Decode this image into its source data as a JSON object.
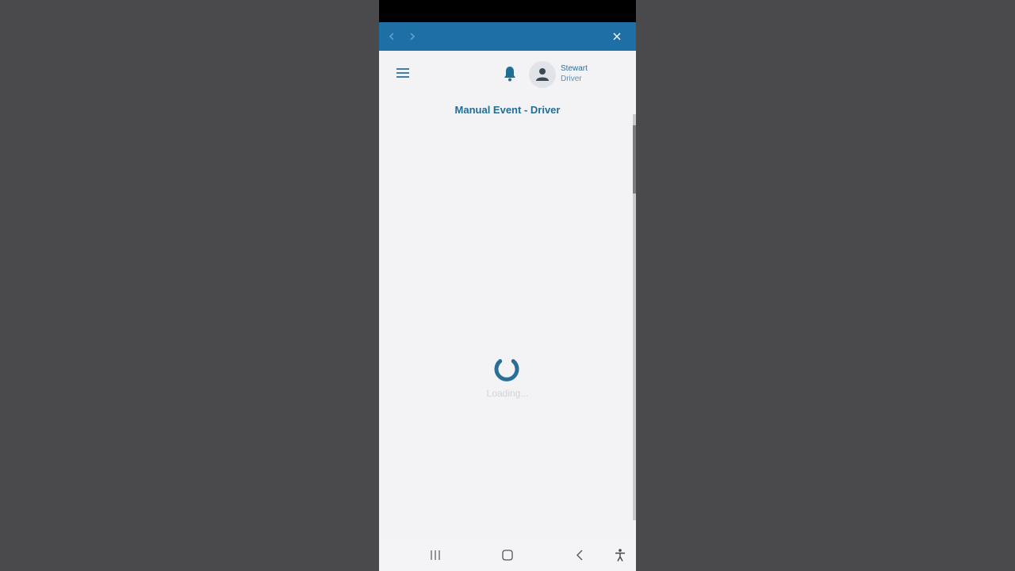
{
  "browser": {
    "back_icon": "chevron-left-icon",
    "forward_icon": "chevron-right-icon",
    "close_icon": "close-icon",
    "bar_color": "#1e6fa5"
  },
  "header": {
    "menu_icon": "hamburger-menu-icon",
    "notification_icon": "bell-icon",
    "avatar_icon": "user-avatar-icon",
    "user_name": "Stewart",
    "user_role": "Driver"
  },
  "page": {
    "title": "Manual Event - Driver",
    "loading_text": "Loading...",
    "accent_color": "#2a6f97"
  },
  "system_nav": {
    "recent_apps_icon": "recent-apps-icon",
    "home_icon": "home-icon",
    "back_icon": "back-icon",
    "accessibility_icon": "accessibility-icon"
  }
}
